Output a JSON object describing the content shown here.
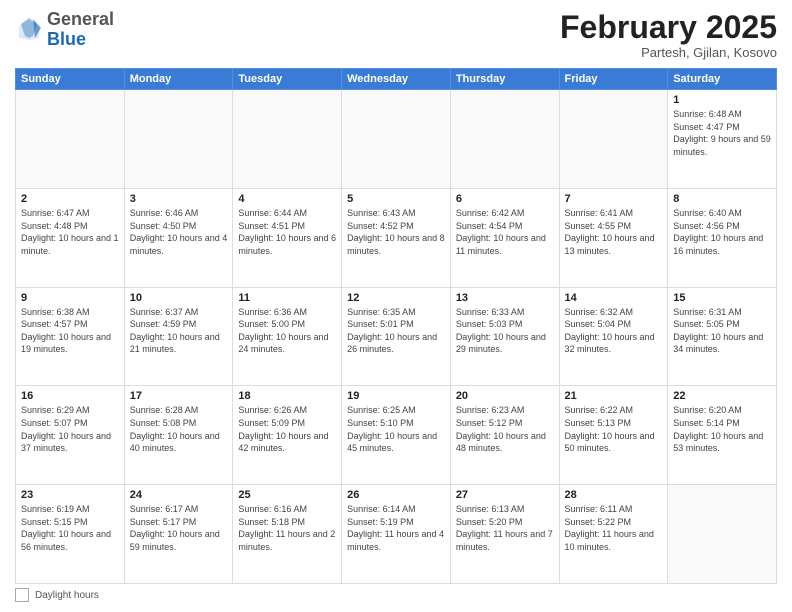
{
  "header": {
    "logo_general": "General",
    "logo_blue": "Blue",
    "month_title": "February 2025",
    "subtitle": "Partesh, Gjilan, Kosovo"
  },
  "days_of_week": [
    "Sunday",
    "Monday",
    "Tuesday",
    "Wednesday",
    "Thursday",
    "Friday",
    "Saturday"
  ],
  "weeks": [
    [
      {
        "day": "",
        "info": ""
      },
      {
        "day": "",
        "info": ""
      },
      {
        "day": "",
        "info": ""
      },
      {
        "day": "",
        "info": ""
      },
      {
        "day": "",
        "info": ""
      },
      {
        "day": "",
        "info": ""
      },
      {
        "day": "1",
        "info": "Sunrise: 6:48 AM\nSunset: 4:47 PM\nDaylight: 9 hours and 59 minutes."
      }
    ],
    [
      {
        "day": "2",
        "info": "Sunrise: 6:47 AM\nSunset: 4:48 PM\nDaylight: 10 hours and 1 minute."
      },
      {
        "day": "3",
        "info": "Sunrise: 6:46 AM\nSunset: 4:50 PM\nDaylight: 10 hours and 4 minutes."
      },
      {
        "day": "4",
        "info": "Sunrise: 6:44 AM\nSunset: 4:51 PM\nDaylight: 10 hours and 6 minutes."
      },
      {
        "day": "5",
        "info": "Sunrise: 6:43 AM\nSunset: 4:52 PM\nDaylight: 10 hours and 8 minutes."
      },
      {
        "day": "6",
        "info": "Sunrise: 6:42 AM\nSunset: 4:54 PM\nDaylight: 10 hours and 11 minutes."
      },
      {
        "day": "7",
        "info": "Sunrise: 6:41 AM\nSunset: 4:55 PM\nDaylight: 10 hours and 13 minutes."
      },
      {
        "day": "8",
        "info": "Sunrise: 6:40 AM\nSunset: 4:56 PM\nDaylight: 10 hours and 16 minutes."
      }
    ],
    [
      {
        "day": "9",
        "info": "Sunrise: 6:38 AM\nSunset: 4:57 PM\nDaylight: 10 hours and 19 minutes."
      },
      {
        "day": "10",
        "info": "Sunrise: 6:37 AM\nSunset: 4:59 PM\nDaylight: 10 hours and 21 minutes."
      },
      {
        "day": "11",
        "info": "Sunrise: 6:36 AM\nSunset: 5:00 PM\nDaylight: 10 hours and 24 minutes."
      },
      {
        "day": "12",
        "info": "Sunrise: 6:35 AM\nSunset: 5:01 PM\nDaylight: 10 hours and 26 minutes."
      },
      {
        "day": "13",
        "info": "Sunrise: 6:33 AM\nSunset: 5:03 PM\nDaylight: 10 hours and 29 minutes."
      },
      {
        "day": "14",
        "info": "Sunrise: 6:32 AM\nSunset: 5:04 PM\nDaylight: 10 hours and 32 minutes."
      },
      {
        "day": "15",
        "info": "Sunrise: 6:31 AM\nSunset: 5:05 PM\nDaylight: 10 hours and 34 minutes."
      }
    ],
    [
      {
        "day": "16",
        "info": "Sunrise: 6:29 AM\nSunset: 5:07 PM\nDaylight: 10 hours and 37 minutes."
      },
      {
        "day": "17",
        "info": "Sunrise: 6:28 AM\nSunset: 5:08 PM\nDaylight: 10 hours and 40 minutes."
      },
      {
        "day": "18",
        "info": "Sunrise: 6:26 AM\nSunset: 5:09 PM\nDaylight: 10 hours and 42 minutes."
      },
      {
        "day": "19",
        "info": "Sunrise: 6:25 AM\nSunset: 5:10 PM\nDaylight: 10 hours and 45 minutes."
      },
      {
        "day": "20",
        "info": "Sunrise: 6:23 AM\nSunset: 5:12 PM\nDaylight: 10 hours and 48 minutes."
      },
      {
        "day": "21",
        "info": "Sunrise: 6:22 AM\nSunset: 5:13 PM\nDaylight: 10 hours and 50 minutes."
      },
      {
        "day": "22",
        "info": "Sunrise: 6:20 AM\nSunset: 5:14 PM\nDaylight: 10 hours and 53 minutes."
      }
    ],
    [
      {
        "day": "23",
        "info": "Sunrise: 6:19 AM\nSunset: 5:15 PM\nDaylight: 10 hours and 56 minutes."
      },
      {
        "day": "24",
        "info": "Sunrise: 6:17 AM\nSunset: 5:17 PM\nDaylight: 10 hours and 59 minutes."
      },
      {
        "day": "25",
        "info": "Sunrise: 6:16 AM\nSunset: 5:18 PM\nDaylight: 11 hours and 2 minutes."
      },
      {
        "day": "26",
        "info": "Sunrise: 6:14 AM\nSunset: 5:19 PM\nDaylight: 11 hours and 4 minutes."
      },
      {
        "day": "27",
        "info": "Sunrise: 6:13 AM\nSunset: 5:20 PM\nDaylight: 11 hours and 7 minutes."
      },
      {
        "day": "28",
        "info": "Sunrise: 6:11 AM\nSunset: 5:22 PM\nDaylight: 11 hours and 10 minutes."
      },
      {
        "day": "",
        "info": ""
      }
    ]
  ],
  "footer": {
    "box_label": "Daylight hours"
  }
}
